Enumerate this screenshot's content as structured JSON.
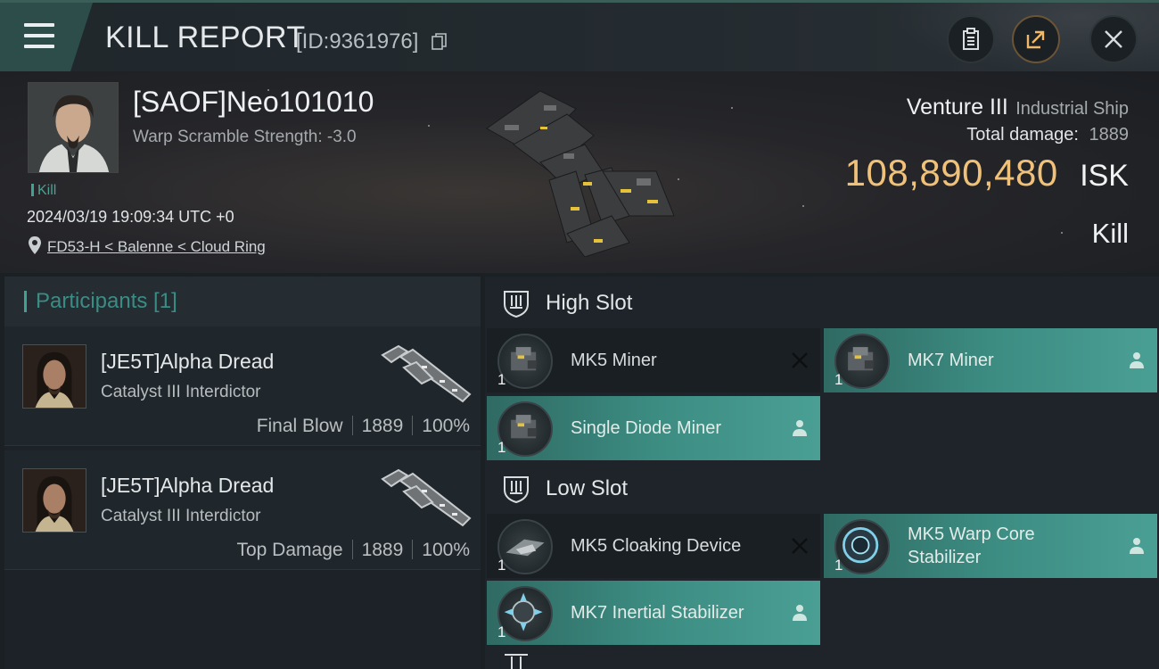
{
  "header": {
    "title": "KILL REPORT",
    "report_id": "[ID:9361976]",
    "icons": [
      "menu-icon",
      "copy-icon",
      "clipboard-icon",
      "share-icon",
      "close-icon"
    ]
  },
  "victim": {
    "name": "[SAOF]Neo101010",
    "warp_scramble": "Warp Scramble Strength: -3.0",
    "tag": "Kill",
    "datetime": "2024/03/19 19:09:34 UTC +0",
    "location": "FD53-H < Balenne < Cloud Ring"
  },
  "ship": {
    "name": "Venture III",
    "class": "Industrial Ship",
    "total_damage_label": "Total damage:",
    "total_damage": "1889",
    "isk_value": "108,890,480",
    "isk_unit": "ISK",
    "result": "Kill"
  },
  "participants": {
    "header": "Participants [1]",
    "items": [
      {
        "name": "[JE5T]Alpha Dread",
        "ship": "Catalyst III Interdictor",
        "role": "Final Blow",
        "damage": "1889",
        "percent": "100%"
      },
      {
        "name": "[JE5T]Alpha Dread",
        "ship": "Catalyst III Interdictor",
        "role": "Top Damage",
        "damage": "1889",
        "percent": "100%"
      }
    ]
  },
  "slots": {
    "high_label": "High Slot",
    "low_label": "Low Slot",
    "high": [
      {
        "name": "MK5 Miner",
        "qty": "1",
        "status": "destroyed"
      },
      {
        "name": "MK7 Miner",
        "qty": "1",
        "status": "dropped"
      },
      {
        "name": "Single Diode Miner",
        "qty": "1",
        "status": "dropped"
      }
    ],
    "low": [
      {
        "name": "MK5 Cloaking Device",
        "qty": "1",
        "status": "destroyed"
      },
      {
        "name": "MK5 Warp Core Stabilizer",
        "qty": "1",
        "status": "dropped"
      },
      {
        "name": "MK7 Inertial Stabilizer",
        "qty": "1",
        "status": "dropped"
      }
    ]
  },
  "colors": {
    "accent": "#3fa293",
    "isk": "#f0c178",
    "teal_row": "#3c8c82"
  }
}
